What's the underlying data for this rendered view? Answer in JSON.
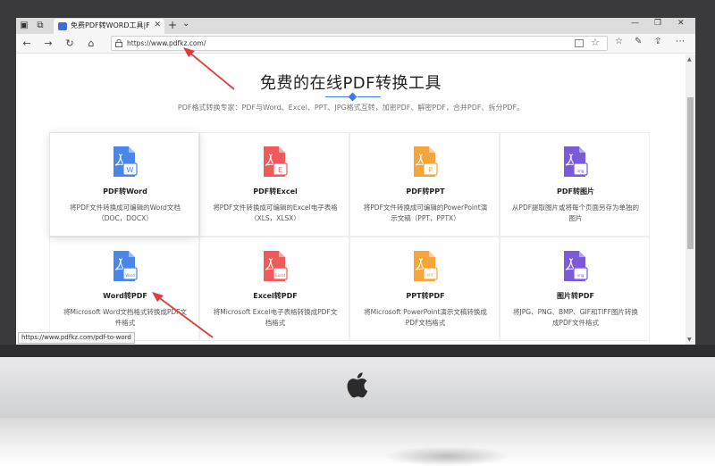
{
  "browser": {
    "tab_title": "免费PDF转WORD工具|F",
    "url": "https://www.pdfkz.com/",
    "status_url": "https://www.pdfkz.com/pdf-to-word"
  },
  "page": {
    "title": "免费的在线PDF转换工具",
    "subtitle": "PDF格式转换专家：PDF与Word、Excel、PPT、JPG格式互转，加密PDF、解密PDF，合并PDF、拆分PDF。"
  },
  "tools": [
    {
      "title": "PDF转Word",
      "desc": "将PDF文件转换成可编辑的Word文档（DOC，DOCX）",
      "icon": "pdf-to-word-icon",
      "color": "#4a86e8",
      "badge": "W"
    },
    {
      "title": "PDF转Excel",
      "desc": "将PDF文件转换成可编辑的Excel电子表格（XLS，XLSX）",
      "icon": "pdf-to-excel-icon",
      "color": "#ef5a5a",
      "badge": "E"
    },
    {
      "title": "PDF转PPT",
      "desc": "将PDF文件转换成可编辑的PowerPoint演示文稿（PPT，PPTX）",
      "icon": "pdf-to-ppt-icon",
      "color": "#f6a53a",
      "badge": "P"
    },
    {
      "title": "PDF转图片",
      "desc": "从PDF提取图片或将每个页面另存为单独的图片",
      "icon": "pdf-to-image-icon",
      "color": "#7b5ad8",
      "badge": "img"
    },
    {
      "title": "Word转PDF",
      "desc": "将Microsoft Word文档格式转换成PDF文件格式",
      "icon": "word-to-pdf-icon",
      "color": "#4a86e8",
      "badge": "Word"
    },
    {
      "title": "Excel转PDF",
      "desc": "将Microsoft Excel电子表格转换成PDF文档格式",
      "icon": "excel-to-pdf-icon",
      "color": "#ef5a5a",
      "badge": "Excel"
    },
    {
      "title": "PPT转PDF",
      "desc": "将Microsoft PowerPoint演示文稿转换成PDF文档格式",
      "icon": "ppt-to-pdf-icon",
      "color": "#f6a53a",
      "badge": "PPT"
    },
    {
      "title": "图片转PDF",
      "desc": "将JPG、PNG、BMP、GIF和TIFF图片转换成PDF文件格式",
      "icon": "image-to-pdf-icon",
      "color": "#7b5ad8",
      "badge": "img"
    }
  ],
  "colors": {
    "accent": "#3d7be8",
    "arrow": "#e23b3b"
  }
}
